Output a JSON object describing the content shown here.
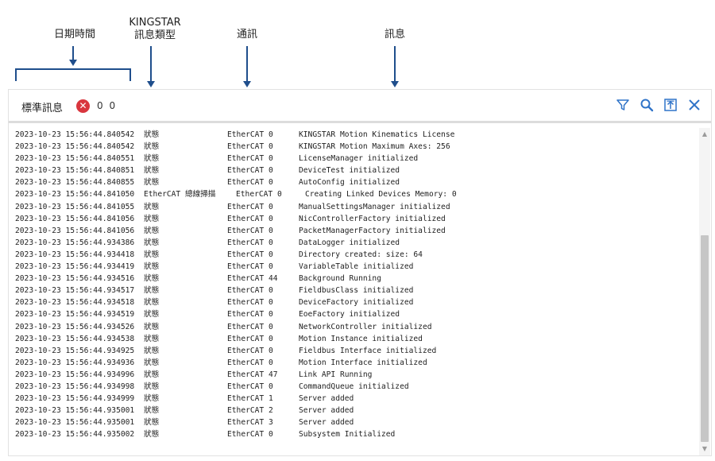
{
  "annotations": {
    "datetime": "日期時間",
    "source_top": "KINGSTAR",
    "source_bottom": "訊息類型",
    "comm": "通訊",
    "message": "訊息"
  },
  "toolbar": {
    "title": "標準訊息",
    "error_icon": "error-x-icon",
    "error_glyph": "✕",
    "counts": "0 0",
    "actions": [
      "filter-icon",
      "search-icon",
      "export-icon",
      "close-icon"
    ],
    "accent": "#2f73c8",
    "error_color": "#d9363e"
  },
  "log": [
    {
      "time": "2023-10-23 15:56:44.840542",
      "type": "狀態",
      "comm": "EtherCAT 0",
      "msg": "KINGSTAR Motion Kinematics License"
    },
    {
      "time": "2023-10-23 15:56:44.840542",
      "type": "狀態",
      "comm": "EtherCAT 0",
      "msg": "KINGSTAR Motion Maximum Axes: 256"
    },
    {
      "time": "2023-10-23 15:56:44.840551",
      "type": "狀態",
      "comm": "EtherCAT 0",
      "msg": "LicenseManager initialized"
    },
    {
      "time": "2023-10-23 15:56:44.840851",
      "type": "狀態",
      "comm": "EtherCAT 0",
      "msg": "DeviceTest initialized"
    },
    {
      "time": "2023-10-23 15:56:44.840855",
      "type": "狀態",
      "comm": "EtherCAT 0",
      "msg": "AutoConfig initialized"
    },
    {
      "time": "2023-10-23 15:56:44.841050",
      "type": "EtherCAT 總線掃描",
      "comm": "EtherCAT 0",
      "msg": "Creating Linked Devices Memory: 0",
      "shift": true
    },
    {
      "time": "2023-10-23 15:56:44.841055",
      "type": "狀態",
      "comm": "EtherCAT 0",
      "msg": "ManualSettingsManager initialized"
    },
    {
      "time": "2023-10-23 15:56:44.841056",
      "type": "狀態",
      "comm": "EtherCAT 0",
      "msg": "NicControllerFactory initialized"
    },
    {
      "time": "2023-10-23 15:56:44.841056",
      "type": "狀態",
      "comm": "EtherCAT 0",
      "msg": "PacketManagerFactory initialized"
    },
    {
      "time": "2023-10-23 15:56:44.934386",
      "type": "狀態",
      "comm": "EtherCAT 0",
      "msg": "DataLogger initialized"
    },
    {
      "time": "2023-10-23 15:56:44.934418",
      "type": "狀態",
      "comm": "EtherCAT 0",
      "msg": "Directory created: size: 64"
    },
    {
      "time": "2023-10-23 15:56:44.934419",
      "type": "狀態",
      "comm": "EtherCAT 0",
      "msg": "VariableTable initialized"
    },
    {
      "time": "2023-10-23 15:56:44.934516",
      "type": "狀態",
      "comm": "EtherCAT 44",
      "msg": "Background Running"
    },
    {
      "time": "2023-10-23 15:56:44.934517",
      "type": "狀態",
      "comm": "EtherCAT 0",
      "msg": "FieldbusClass initialized"
    },
    {
      "time": "2023-10-23 15:56:44.934518",
      "type": "狀態",
      "comm": "EtherCAT 0",
      "msg": "DeviceFactory initialized"
    },
    {
      "time": "2023-10-23 15:56:44.934519",
      "type": "狀態",
      "comm": "EtherCAT 0",
      "msg": "EoeFactory initialized"
    },
    {
      "time": "2023-10-23 15:56:44.934526",
      "type": "狀態",
      "comm": "EtherCAT 0",
      "msg": "NetworkController initialized"
    },
    {
      "time": "2023-10-23 15:56:44.934538",
      "type": "狀態",
      "comm": "EtherCAT 0",
      "msg": "Motion Instance initialized"
    },
    {
      "time": "2023-10-23 15:56:44.934925",
      "type": "狀態",
      "comm": "EtherCAT 0",
      "msg": "Fieldbus Interface initialized"
    },
    {
      "time": "2023-10-23 15:56:44.934936",
      "type": "狀態",
      "comm": "EtherCAT 0",
      "msg": "Motion Interface initialized"
    },
    {
      "time": "2023-10-23 15:56:44.934996",
      "type": "狀態",
      "comm": "EtherCAT 47",
      "msg": "Link API Running"
    },
    {
      "time": "2023-10-23 15:56:44.934998",
      "type": "狀態",
      "comm": "EtherCAT 0",
      "msg": "CommandQueue initialized"
    },
    {
      "time": "2023-10-23 15:56:44.934999",
      "type": "狀態",
      "comm": "EtherCAT 1",
      "msg": "Server added"
    },
    {
      "time": "2023-10-23 15:56:44.935001",
      "type": "狀態",
      "comm": "EtherCAT 2",
      "msg": "Server added"
    },
    {
      "time": "2023-10-23 15:56:44.935001",
      "type": "狀態",
      "comm": "EtherCAT 3",
      "msg": "Server added"
    },
    {
      "time": "2023-10-23 15:56:44.935002",
      "type": "狀態",
      "comm": "EtherCAT 0",
      "msg": "Subsystem Initialized"
    }
  ],
  "scrollbar": {
    "up_glyph": "▲",
    "down_glyph": "▼"
  }
}
